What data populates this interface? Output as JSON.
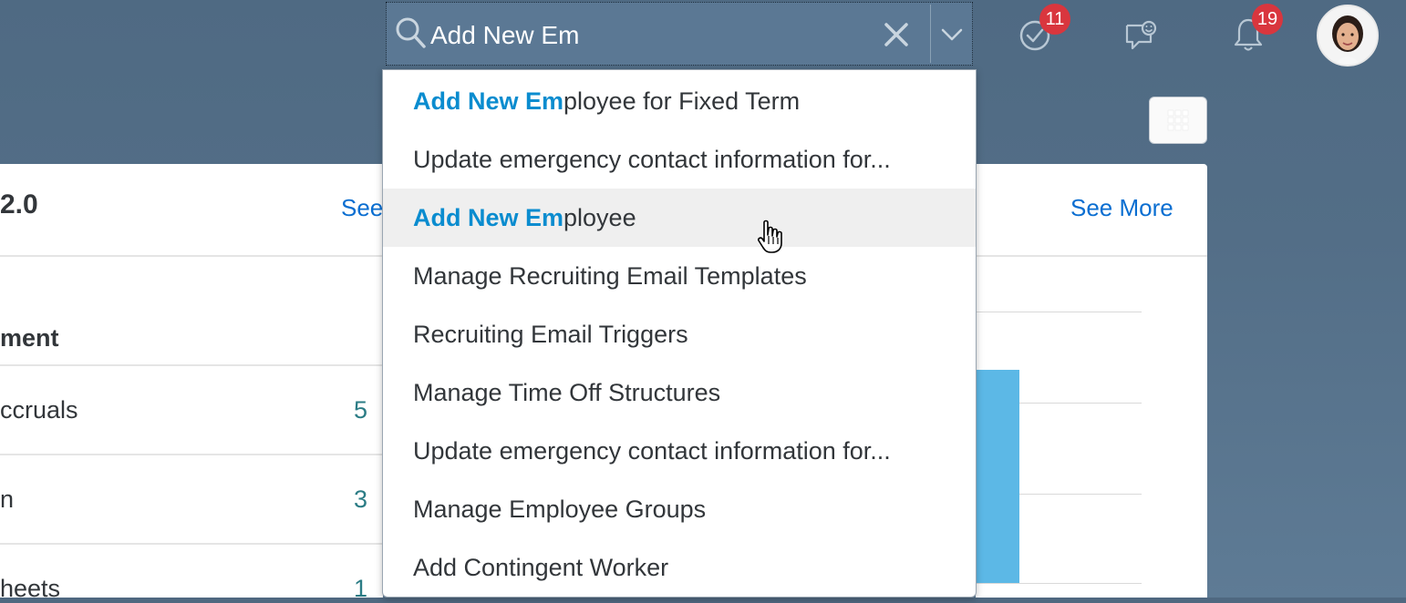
{
  "search": {
    "value": "Add New Em",
    "highlight": "Add New Em"
  },
  "header": {
    "todo_badge": "11",
    "notifications_badge": "19"
  },
  "dropdown": {
    "items": [
      {
        "hl": "Add New Em",
        "rest": "ployee for Fixed Term",
        "hover": false
      },
      {
        "hl": "",
        "rest": "Update emergency contact information for...",
        "hover": false
      },
      {
        "hl": "Add New Em",
        "rest": "ployee",
        "hover": true
      },
      {
        "hl": "",
        "rest": "Manage Recruiting Email Templates",
        "hover": false
      },
      {
        "hl": "",
        "rest": "Recruiting Email Triggers",
        "hover": false
      },
      {
        "hl": "",
        "rest": "Manage Time Off Structures",
        "hover": false
      },
      {
        "hl": "",
        "rest": "Update emergency contact information for...",
        "hover": false
      },
      {
        "hl": "",
        "rest": "Manage Employee Groups",
        "hover": false
      },
      {
        "hl": "",
        "rest": "Add Contingent Worker",
        "hover": false
      }
    ]
  },
  "left_card": {
    "title": "2.0",
    "see_more": "See",
    "column_header": "ment",
    "rows": [
      {
        "label": "ccruals",
        "count": "5"
      },
      {
        "label": "n",
        "count": "3"
      },
      {
        "label": "heets",
        "count": "1"
      }
    ]
  },
  "right_card": {
    "see_more": "See More"
  },
  "colors": {
    "shell": "#4f6880",
    "accent": "#0a6ed1",
    "highlight": "#0a8ccf",
    "badge": "#d9363e",
    "bar": "#5cb8e6"
  }
}
